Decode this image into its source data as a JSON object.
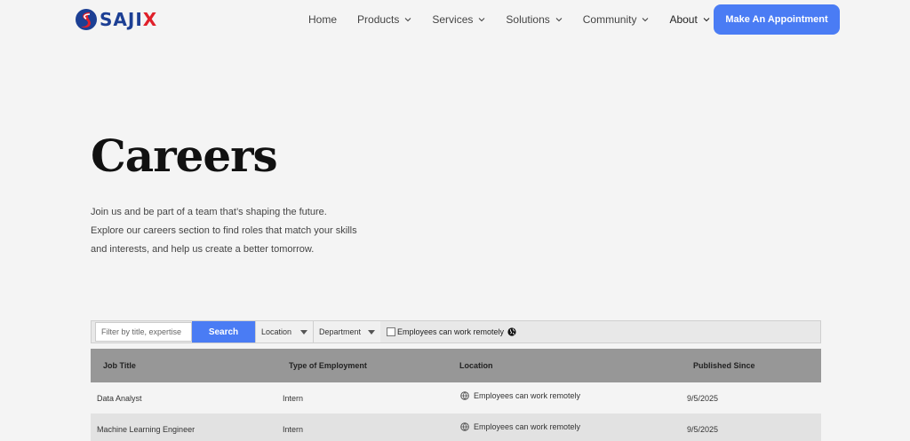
{
  "brand": {
    "name_main": "SAJI",
    "name_accent": "X",
    "colors": {
      "blue": "#1c3f94",
      "red": "#e0202a"
    }
  },
  "nav": {
    "items": [
      {
        "label": "Home",
        "has_dropdown": false
      },
      {
        "label": "Products",
        "has_dropdown": true
      },
      {
        "label": "Services",
        "has_dropdown": true
      },
      {
        "label": "Solutions",
        "has_dropdown": true
      },
      {
        "label": "Community",
        "has_dropdown": true
      },
      {
        "label": "About",
        "has_dropdown": true
      }
    ],
    "cta_label": "Make An Appointment"
  },
  "hero": {
    "title": "Careers",
    "lines": [
      "Join us and be part of a team that’s shaping the future.",
      "Explore our careers section to find roles that match your skills",
      "and interests, and help us create a better tomorrow."
    ]
  },
  "filters": {
    "search_placeholder": "Filter by title, expertise",
    "search_button": "Search",
    "location_select": "Location",
    "department_select": "Department",
    "remote_label": "Employees can work remotely",
    "remote_checked": false,
    "accent": "#4a7cf4"
  },
  "table": {
    "headers": [
      "Job Title",
      "Type of Employment",
      "Location",
      "Published Since"
    ],
    "rows": [
      {
        "title": "Data Analyst",
        "type": "Intern",
        "location": "Employees can work remotely",
        "published": "9/5/2025"
      },
      {
        "title": "Machine Learning Engineer",
        "type": "Intern",
        "location": "Employees can work remotely",
        "published": "9/5/2025"
      }
    ]
  }
}
